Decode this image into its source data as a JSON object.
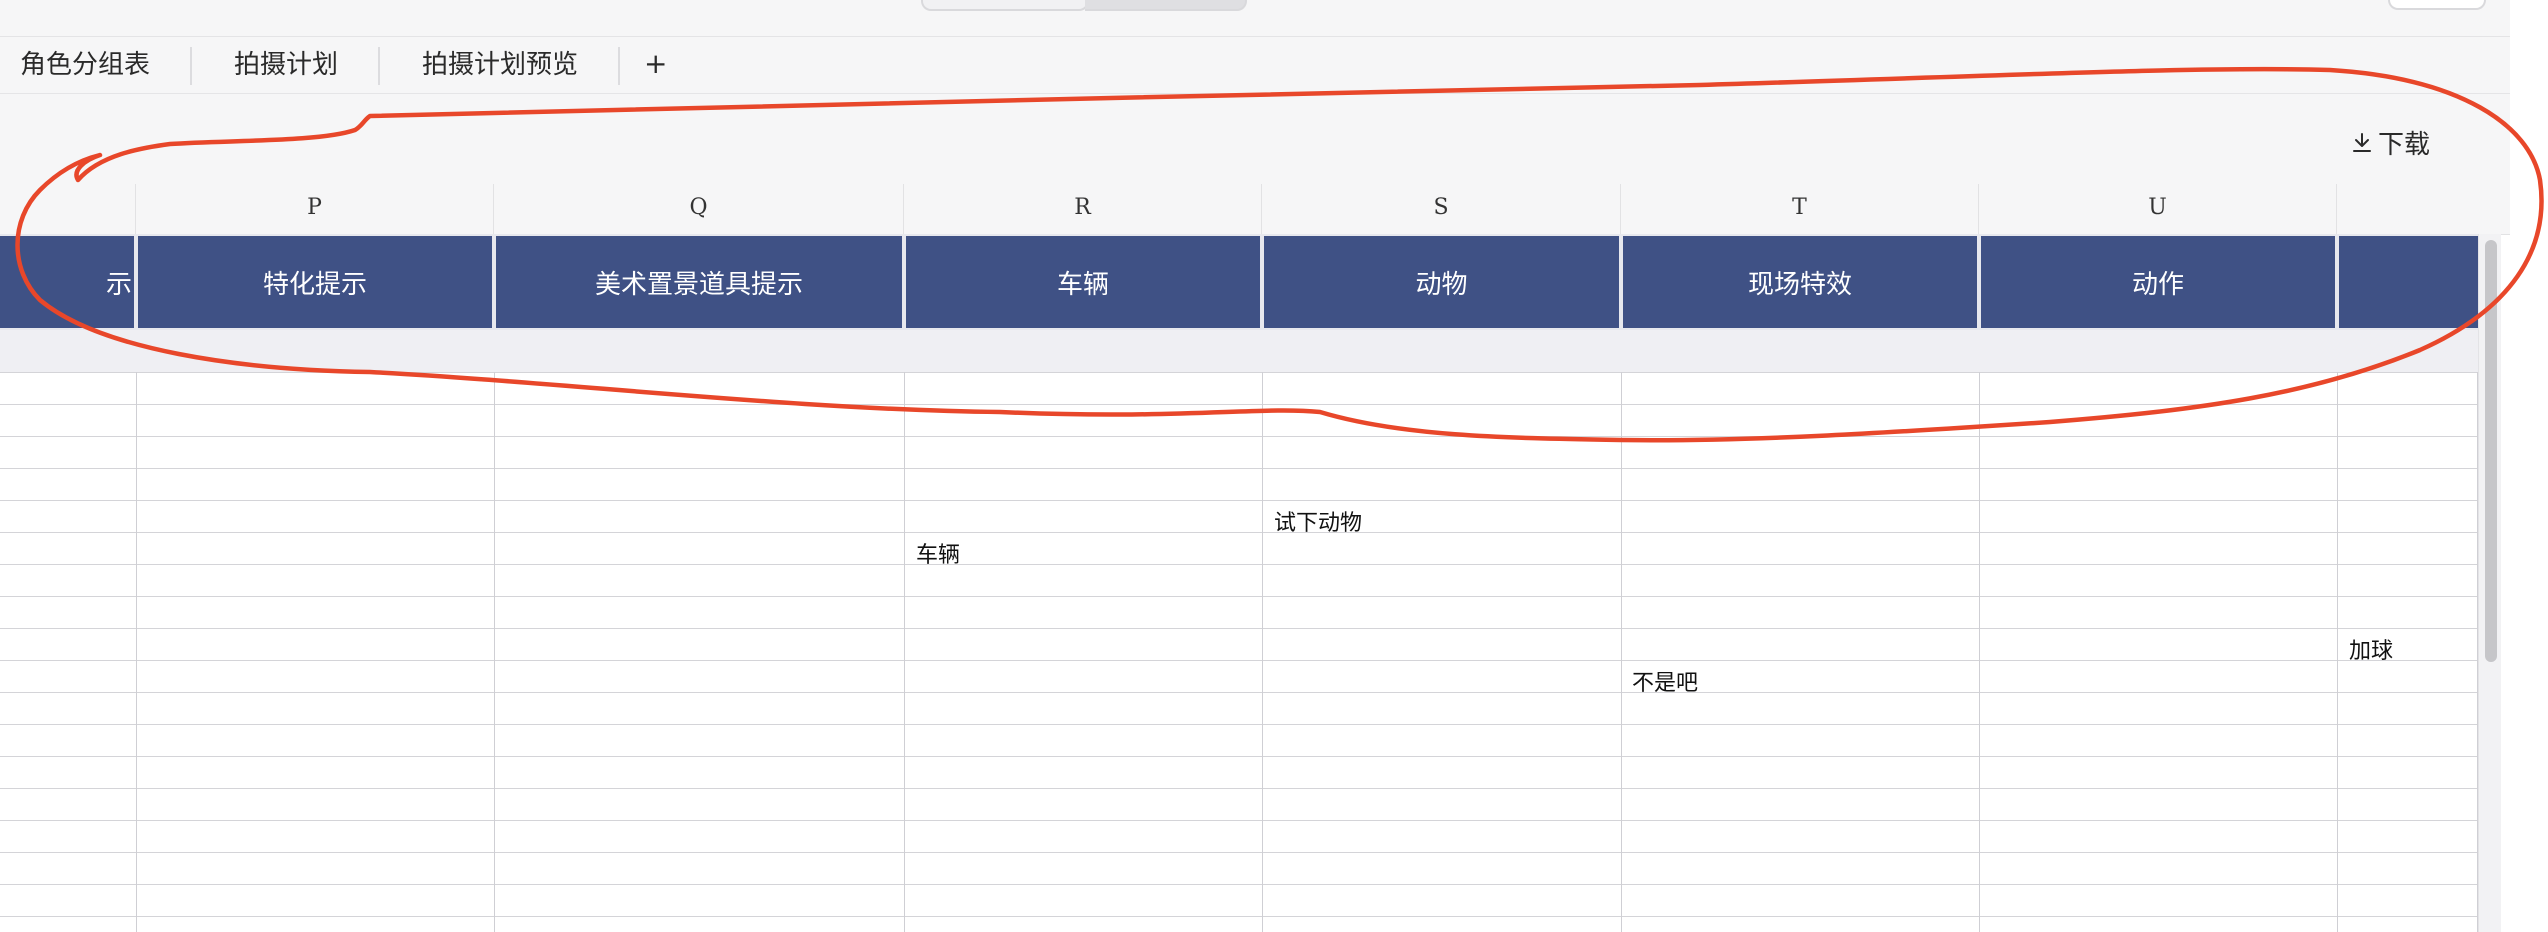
{
  "tabs": {
    "items": [
      {
        "label": "角色分组表"
      },
      {
        "label": "拍摄计划"
      },
      {
        "label": "拍摄计划预览"
      }
    ],
    "add_label": "+"
  },
  "toolbar": {
    "download_label": "下载",
    "download_icon": "download-icon"
  },
  "sheet": {
    "column_letters": [
      "P",
      "Q",
      "R",
      "S",
      "T",
      "U"
    ],
    "header_fragment": "示",
    "headers": [
      "特化提示",
      "美术置景道具提示",
      "车辆",
      "动物",
      "现场特效",
      "动作"
    ],
    "cells": [
      {
        "column": "S",
        "row": 5,
        "text": "试下动物"
      },
      {
        "column": "R",
        "row": 6,
        "text": "车辆"
      },
      {
        "column": "V",
        "row": 9,
        "text": "加球"
      },
      {
        "column": "T",
        "row": 10,
        "text": "不是吧"
      }
    ]
  },
  "annotation": {
    "type": "freehand-ellipse",
    "color": "#e8472a"
  }
}
